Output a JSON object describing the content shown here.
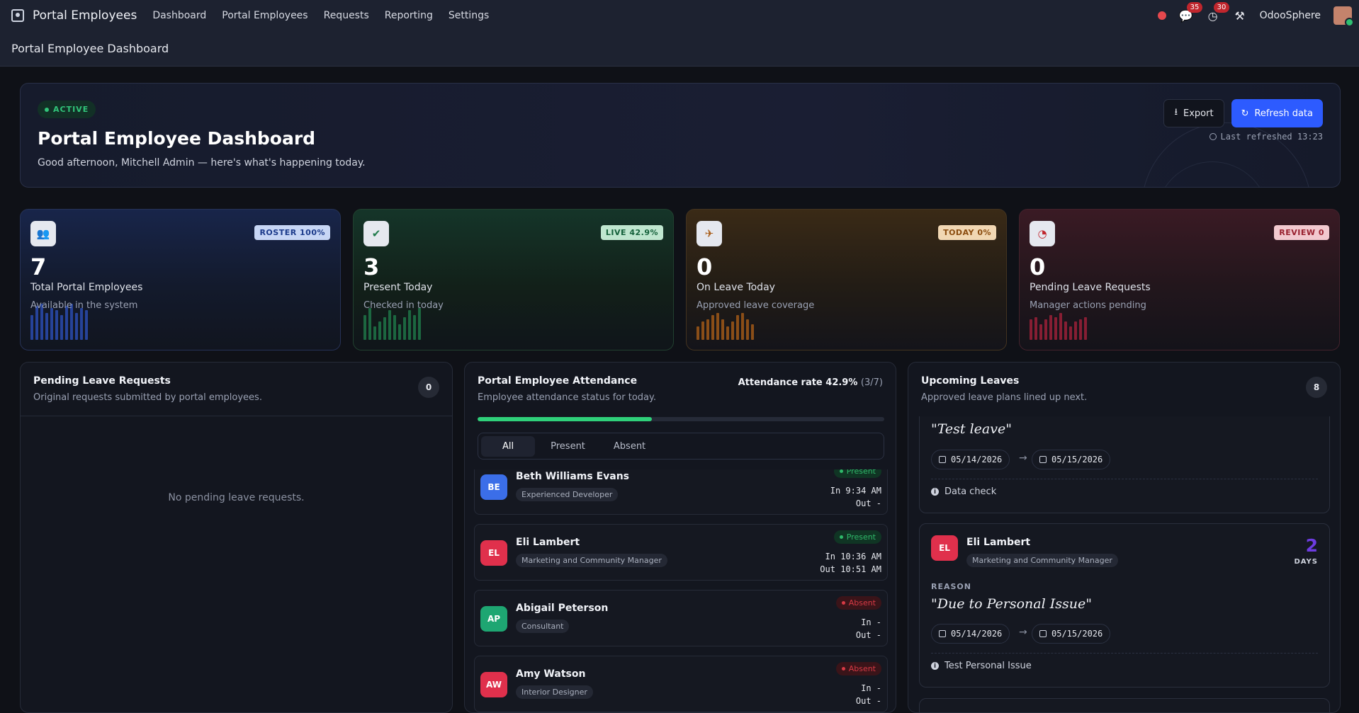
{
  "nav": {
    "brand": "Portal Employees",
    "links": [
      "Dashboard",
      "Portal Employees",
      "Requests",
      "Reporting",
      "Settings"
    ],
    "messages_count": "35",
    "activities_count": "30",
    "company": "OdooSphere"
  },
  "breadcrumb": "Portal Employee Dashboard",
  "hero": {
    "status": "ACTIVE",
    "title": "Portal Employee Dashboard",
    "greeting": "Good afternoon, Mitchell Admin — here's what's happening today.",
    "export_label": "Export",
    "refresh_label": "Refresh data",
    "last_refreshed": "Last refreshed 13:23"
  },
  "kpis": [
    {
      "icon": "users-icon",
      "badge": "ROSTER  100%",
      "value": "7",
      "label": "Total Portal Employees",
      "sub": "Available in the system",
      "spark": [
        0.55,
        0.75,
        0.8,
        0.6,
        0.7,
        0.65,
        0.55,
        0.75,
        0.8,
        0.6,
        0.7,
        0.65
      ]
    },
    {
      "icon": "check-icon",
      "badge": "LIVE  42.9%",
      "value": "3",
      "label": "Present Today",
      "sub": "Checked in today",
      "spark": [
        0.55,
        0.7,
        0.3,
        0.4,
        0.5,
        0.65,
        0.55,
        0.35,
        0.5,
        0.65,
        0.55,
        0.7
      ]
    },
    {
      "icon": "plane-icon",
      "badge": "TODAY  0%",
      "value": "0",
      "label": "On Leave Today",
      "sub": "Approved leave coverage",
      "spark": [
        0.3,
        0.4,
        0.45,
        0.55,
        0.6,
        0.45,
        0.3,
        0.4,
        0.55,
        0.6,
        0.45,
        0.35
      ]
    },
    {
      "icon": "alert-icon",
      "badge": "REVIEW  0",
      "value": "0",
      "label": "Pending Leave Requests",
      "sub": "Manager actions pending",
      "spark": [
        0.45,
        0.5,
        0.35,
        0.45,
        0.55,
        0.5,
        0.6,
        0.4,
        0.3,
        0.4,
        0.45,
        0.5
      ]
    }
  ],
  "pending": {
    "title": "Pending Leave Requests",
    "sub": "Original requests submitted by portal employees.",
    "count": "0",
    "empty": "No pending leave requests."
  },
  "attendance": {
    "title": "Portal Employee Attendance",
    "sub": "Employee attendance status for today.",
    "rate_label": "Attendance rate 42.9%",
    "rate_frac": "(3/7)",
    "rate": 0.429,
    "tabs": [
      "All",
      "Present",
      "Absent"
    ],
    "rows": [
      {
        "initials": "BE",
        "color": "#3b6ee8",
        "name": "Beth Williams Evans",
        "job": "Experienced Developer",
        "status": "Present",
        "in": "In 9:34 AM",
        "out": "Out -"
      },
      {
        "initials": "EL",
        "color": "#e0304c",
        "name": "Eli Lambert",
        "job": "Marketing and Community Manager",
        "status": "Present",
        "in": "In 10:36 AM",
        "out": "Out 10:51 AM"
      },
      {
        "initials": "AP",
        "color": "#1ea672",
        "name": "Abigail Peterson",
        "job": "Consultant",
        "status": "Absent",
        "in": "In -",
        "out": "Out -"
      },
      {
        "initials": "AW",
        "color": "#e0304c",
        "name": "Amy Watson",
        "job": "Interior Designer",
        "status": "Absent",
        "in": "In -",
        "out": "Out -"
      }
    ]
  },
  "upcoming": {
    "title": "Upcoming Leaves",
    "sub": "Approved leave plans lined up next.",
    "count": "8",
    "reason_label": "REASON",
    "days_label": "DAYS",
    "items": [
      {
        "reason": "\"Test leave\"",
        "from": "05/14/2026",
        "to": "05/15/2026",
        "note": "Data check"
      },
      {
        "initials": "EL",
        "color": "#e0304c",
        "name": "Eli Lambert",
        "job": "Marketing and Community Manager",
        "days": "2",
        "reason": "\"Due to Personal Issue\"",
        "from": "05/14/2026",
        "to": "05/15/2026",
        "note": "Test Personal Issue"
      }
    ]
  }
}
